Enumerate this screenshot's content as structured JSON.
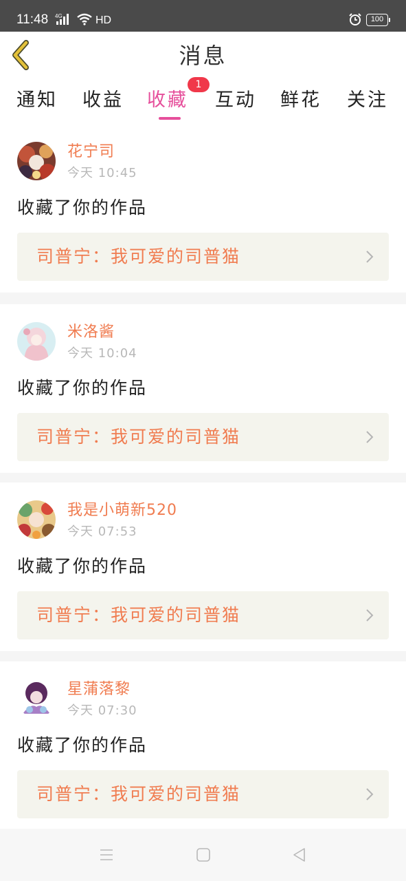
{
  "status_bar": {
    "time": "11:48",
    "network": "4G",
    "hd": "HD",
    "battery": "100"
  },
  "header": {
    "title": "消息",
    "back_icon": "chevron-left-icon",
    "accent_color": "#e3c13a"
  },
  "tabs": [
    {
      "label": "通知"
    },
    {
      "label": "收益"
    },
    {
      "label": "收藏",
      "active": true,
      "badge": "1"
    },
    {
      "label": "互动"
    },
    {
      "label": "鲜花"
    },
    {
      "label": "关注"
    }
  ],
  "colors": {
    "active_tab": "#e64f9b",
    "badge": "#f0384a",
    "username": "#f07c50",
    "link_bg": "#f4f4ed"
  },
  "messages": [
    {
      "username": "花宁司",
      "time": "今天 10:45",
      "action": "收藏了你的作品",
      "work": "司普宁：我可爱的司普猫"
    },
    {
      "username": "米洛酱",
      "time": "今天 10:04",
      "action": "收藏了你的作品",
      "work": "司普宁：我可爱的司普猫"
    },
    {
      "username": "我是小萌新520",
      "time": "今天 07:53",
      "action": "收藏了你的作品",
      "work": "司普宁：我可爱的司普猫"
    },
    {
      "username": "星蒲落黎",
      "time": "今天 07:30",
      "action": "收藏了你的作品",
      "work": "司普宁：我可爱的司普猫"
    }
  ],
  "nav_bar": {
    "menu_icon": "menu-icon",
    "home_icon": "home-square-icon",
    "back_icon": "triangle-back-icon"
  }
}
